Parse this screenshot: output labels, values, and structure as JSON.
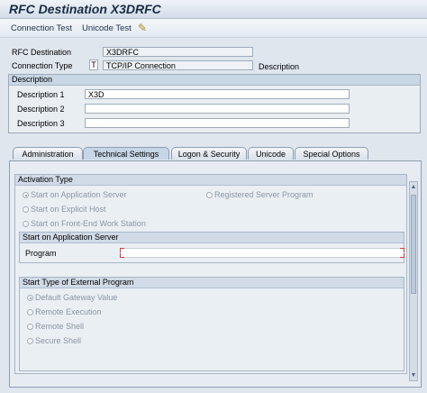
{
  "window": {
    "title": "RFC Destination X3DRFC"
  },
  "toolbar": {
    "connection_test": "Connection Test",
    "unicode_test": "Unicode Test",
    "edit_icon": "pencil-icon"
  },
  "header": {
    "rfc_destination_label": "RFC Destination",
    "rfc_destination_value": "X3DRFC",
    "connection_type_label": "Connection Type",
    "connection_type_code": "T",
    "connection_type_value": "TCP/IP Connection",
    "description_label": "Description"
  },
  "description": {
    "title": "Description",
    "rows": [
      {
        "label": "Description 1",
        "value": "X3D"
      },
      {
        "label": "Description 2",
        "value": ""
      },
      {
        "label": "Description 3",
        "value": ""
      }
    ]
  },
  "tabs": [
    {
      "label": "Administration",
      "active": false
    },
    {
      "label": "Technical Settings",
      "active": true
    },
    {
      "label": "Logon & Security",
      "active": false
    },
    {
      "label": "Unicode",
      "active": false
    },
    {
      "label": "Special Options",
      "active": false
    }
  ],
  "activation_type": {
    "title": "Activation Type",
    "options": [
      {
        "label": "Start on Application Server",
        "selected": true
      },
      {
        "label": "Registered Server Program",
        "selected": false
      },
      {
        "label": "Start on Explicit Host",
        "selected": false
      },
      {
        "label": "Start on Front-End Work Station",
        "selected": false
      }
    ]
  },
  "app_server": {
    "title": "Start on Application Server",
    "program_label": "Program",
    "program_value": ""
  },
  "external_program": {
    "title": "Start Type of External Program",
    "options": [
      {
        "label": "Default Gateway Value",
        "selected": true
      },
      {
        "label": "Remote Execution",
        "selected": false
      },
      {
        "label": "Remote Shell",
        "selected": false
      },
      {
        "label": "Secure Shell",
        "selected": false
      }
    ]
  },
  "colors": {
    "background": "#dfe6ee",
    "header_band": "#c9d6e4",
    "error_marker": "#d33a3a"
  }
}
